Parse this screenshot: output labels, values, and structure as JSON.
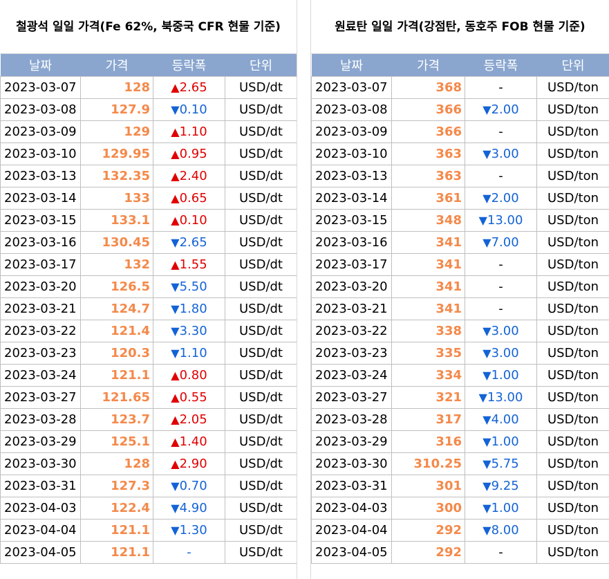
{
  "left": {
    "title": "철광석 일일 가격(Fe 62%, 북중국 CFR 현물 기준)",
    "headers": [
      "날짜",
      "가격",
      "등락폭",
      "단위"
    ],
    "rows": [
      {
        "date": "2023-03-07",
        "price": "128",
        "dir": "up",
        "change": "2.65",
        "unit": "USD/dt"
      },
      {
        "date": "2023-03-08",
        "price": "127.9",
        "dir": "down",
        "change": "0.10",
        "unit": "USD/dt"
      },
      {
        "date": "2023-03-09",
        "price": "129",
        "dir": "up",
        "change": "1.10",
        "unit": "USD/dt"
      },
      {
        "date": "2023-03-10",
        "price": "129.95",
        "dir": "up",
        "change": "0.95",
        "unit": "USD/dt"
      },
      {
        "date": "2023-03-13",
        "price": "132.35",
        "dir": "up",
        "change": "2.40",
        "unit": "USD/dt"
      },
      {
        "date": "2023-03-14",
        "price": "133",
        "dir": "up",
        "change": "0.65",
        "unit": "USD/dt"
      },
      {
        "date": "2023-03-15",
        "price": "133.1",
        "dir": "up",
        "change": "0.10",
        "unit": "USD/dt"
      },
      {
        "date": "2023-03-16",
        "price": "130.45",
        "dir": "down",
        "change": "2.65",
        "unit": "USD/dt"
      },
      {
        "date": "2023-03-17",
        "price": "132",
        "dir": "up",
        "change": "1.55",
        "unit": "USD/dt"
      },
      {
        "date": "2023-03-20",
        "price": "126.5",
        "dir": "down",
        "change": "5.50",
        "unit": "USD/dt"
      },
      {
        "date": "2023-03-21",
        "price": "124.7",
        "dir": "down",
        "change": "1.80",
        "unit": "USD/dt"
      },
      {
        "date": "2023-03-22",
        "price": "121.4",
        "dir": "down",
        "change": "3.30",
        "unit": "USD/dt"
      },
      {
        "date": "2023-03-23",
        "price": "120.3",
        "dir": "down",
        "change": "1.10",
        "unit": "USD/dt"
      },
      {
        "date": "2023-03-24",
        "price": "121.1",
        "dir": "up",
        "change": "0.80",
        "unit": "USD/dt"
      },
      {
        "date": "2023-03-27",
        "price": "121.65",
        "dir": "up",
        "change": "0.55",
        "unit": "USD/dt"
      },
      {
        "date": "2023-03-28",
        "price": "123.7",
        "dir": "up",
        "change": "2.05",
        "unit": "USD/dt"
      },
      {
        "date": "2023-03-29",
        "price": "125.1",
        "dir": "up",
        "change": "1.40",
        "unit": "USD/dt"
      },
      {
        "date": "2023-03-30",
        "price": "128",
        "dir": "up",
        "change": "2.90",
        "unit": "USD/dt"
      },
      {
        "date": "2023-03-31",
        "price": "127.3",
        "dir": "down",
        "change": "0.70",
        "unit": "USD/dt"
      },
      {
        "date": "2023-04-03",
        "price": "122.4",
        "dir": "down",
        "change": "4.90",
        "unit": "USD/dt"
      },
      {
        "date": "2023-04-04",
        "price": "121.1",
        "dir": "down",
        "change": "1.30",
        "unit": "USD/dt"
      },
      {
        "date": "2023-04-05",
        "price": "121.1",
        "dir": "flat",
        "change": "-",
        "unit": "USD/dt"
      }
    ]
  },
  "right": {
    "title": "원료탄 일일 가격(강점탄, 동호주 FOB 현물 기준)",
    "headers": [
      "날짜",
      "가격",
      "등락폭",
      "단위"
    ],
    "rows": [
      {
        "date": "2023-03-07",
        "price": "368",
        "dir": "flat",
        "change": "-",
        "unit": "USD/ton"
      },
      {
        "date": "2023-03-08",
        "price": "366",
        "dir": "down",
        "change": "2.00",
        "unit": "USD/ton"
      },
      {
        "date": "2023-03-09",
        "price": "366",
        "dir": "flat",
        "change": "-",
        "unit": "USD/ton"
      },
      {
        "date": "2023-03-10",
        "price": "363",
        "dir": "down",
        "change": "3.00",
        "unit": "USD/ton"
      },
      {
        "date": "2023-03-13",
        "price": "363",
        "dir": "flat",
        "change": "-",
        "unit": "USD/ton"
      },
      {
        "date": "2023-03-14",
        "price": "361",
        "dir": "down",
        "change": "2.00",
        "unit": "USD/ton"
      },
      {
        "date": "2023-03-15",
        "price": "348",
        "dir": "down",
        "change": "13.00",
        "unit": "USD/ton"
      },
      {
        "date": "2023-03-16",
        "price": "341",
        "dir": "down",
        "change": "7.00",
        "unit": "USD/ton"
      },
      {
        "date": "2023-03-17",
        "price": "341",
        "dir": "flat",
        "change": "-",
        "unit": "USD/ton"
      },
      {
        "date": "2023-03-20",
        "price": "341",
        "dir": "flat",
        "change": "-",
        "unit": "USD/ton"
      },
      {
        "date": "2023-03-21",
        "price": "341",
        "dir": "flat",
        "change": "-",
        "unit": "USD/ton"
      },
      {
        "date": "2023-03-22",
        "price": "338",
        "dir": "down",
        "change": "3.00",
        "unit": "USD/ton"
      },
      {
        "date": "2023-03-23",
        "price": "335",
        "dir": "down",
        "change": "3.00",
        "unit": "USD/ton"
      },
      {
        "date": "2023-03-24",
        "price": "334",
        "dir": "down",
        "change": "1.00",
        "unit": "USD/ton"
      },
      {
        "date": "2023-03-27",
        "price": "321",
        "dir": "down",
        "change": "13.00",
        "unit": "USD/ton"
      },
      {
        "date": "2023-03-28",
        "price": "317",
        "dir": "down",
        "change": "4.00",
        "unit": "USD/ton"
      },
      {
        "date": "2023-03-29",
        "price": "316",
        "dir": "down",
        "change": "1.00",
        "unit": "USD/ton"
      },
      {
        "date": "2023-03-30",
        "price": "310.25",
        "dir": "down",
        "change": "5.75",
        "unit": "USD/ton"
      },
      {
        "date": "2023-03-31",
        "price": "301",
        "dir": "down",
        "change": "9.25",
        "unit": "USD/ton"
      },
      {
        "date": "2023-04-03",
        "price": "300",
        "dir": "down",
        "change": "1.00",
        "unit": "USD/ton"
      },
      {
        "date": "2023-04-04",
        "price": "292",
        "dir": "down",
        "change": "8.00",
        "unit": "USD/ton"
      },
      {
        "date": "2023-04-05",
        "price": "292",
        "dir": "flat",
        "change": "-",
        "unit": "USD/ton"
      }
    ]
  },
  "arrows": {
    "up": "▲",
    "down": "▼"
  },
  "colors": {
    "header_bg": "#8aa6cf",
    "price": "#f4894a",
    "up": "#e00000",
    "down": "#1463d6"
  }
}
